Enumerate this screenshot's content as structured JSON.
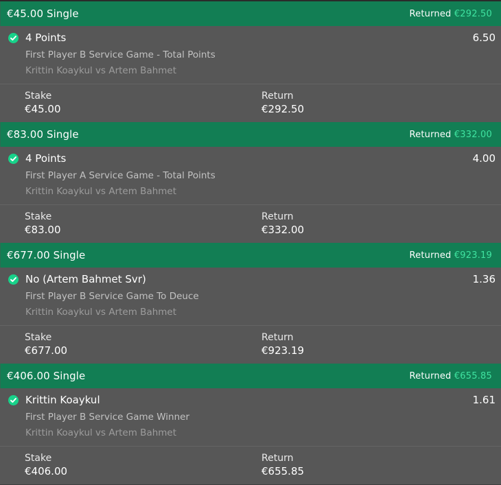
{
  "bets": [
    {
      "title": "€45.00 Single",
      "returned_label": "Returned",
      "returned_amount": "€292.50",
      "selection": "4 Points",
      "odds": "6.50",
      "market": "First Player B Service Game - Total Points",
      "event": "Krittin Koaykul vs Artem Bahmet",
      "stake_label": "Stake",
      "stake": "€45.00",
      "return_label": "Return",
      "return": "€292.50"
    },
    {
      "title": "€83.00 Single",
      "returned_label": "Returned",
      "returned_amount": "€332.00",
      "selection": "4 Points",
      "odds": "4.00",
      "market": "First Player A Service Game - Total Points",
      "event": "Krittin Koaykul vs Artem Bahmet",
      "stake_label": "Stake",
      "stake": "€83.00",
      "return_label": "Return",
      "return": "€332.00"
    },
    {
      "title": "€677.00 Single",
      "returned_label": "Returned",
      "returned_amount": "€923.19",
      "selection": "No (Artem Bahmet Svr)",
      "odds": "1.36",
      "market": "First Player B Service Game To Deuce",
      "event": "Krittin Koaykul vs Artem Bahmet",
      "stake_label": "Stake",
      "stake": "€677.00",
      "return_label": "Return",
      "return": "€923.19"
    },
    {
      "title": "€406.00 Single",
      "returned_label": "Returned",
      "returned_amount": "€655.85",
      "selection": "Krittin Koaykul",
      "odds": "1.61",
      "market": "First Player B Service Game Winner",
      "event": "Krittin Koaykul vs Artem Bahmet",
      "stake_label": "Stake",
      "stake": "€406.00",
      "return_label": "Return",
      "return": "€655.85"
    }
  ],
  "colors": {
    "header_green": "#127e54",
    "returned_amount": "#3fe3a0",
    "check_icon": "#18d28a",
    "panel_bg": "#575757"
  },
  "icons": {
    "settled": "check-circle-icon"
  }
}
